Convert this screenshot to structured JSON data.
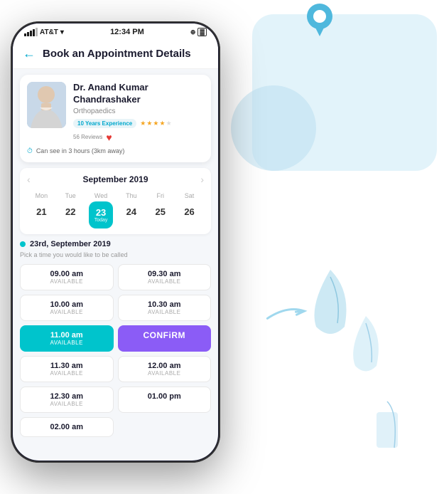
{
  "app": {
    "status_bar": {
      "carrier": "AT&T",
      "time": "12:34 PM",
      "battery": "battery"
    },
    "header": {
      "back_label": "←",
      "title": "Book an Appointment Details"
    },
    "doctor": {
      "name": "Dr. Anand Kumar Chandrashaker",
      "specialty": "Orthopaedics",
      "experience_badge": "10 Years Experience",
      "rating": 4,
      "reviews": "56 Reviews",
      "availability": "Can see in 3 hours (3km away)"
    },
    "calendar": {
      "month": "September 2019",
      "days": [
        {
          "name": "Mon",
          "num": "21",
          "active": false
        },
        {
          "name": "Tue",
          "num": "22",
          "active": false
        },
        {
          "name": "Wed",
          "num": "23",
          "active": true,
          "today": "Today"
        },
        {
          "name": "Thu",
          "num": "24",
          "active": false
        },
        {
          "name": "Fri",
          "num": "25",
          "active": false
        },
        {
          "name": "Sat",
          "num": "26",
          "active": false
        }
      ]
    },
    "date_label": "23rd, September 2019",
    "pick_prompt": "Pick a time you would like to be called",
    "slots": [
      {
        "time": "09.00 am",
        "status": "AVAILABLE",
        "selected": false,
        "confirm": false
      },
      {
        "time": "09.30 am",
        "status": "AVAILABLE",
        "selected": false,
        "confirm": false
      },
      {
        "time": "10.00 am",
        "status": "AVAILABLE",
        "selected": false,
        "confirm": false
      },
      {
        "time": "10.30 am",
        "status": "AVAILABLE",
        "selected": false,
        "confirm": false
      },
      {
        "time": "11.00 am",
        "status": "AVAILABLE",
        "selected": true,
        "confirm": false
      },
      {
        "time": "CONFiRM",
        "status": "",
        "selected": false,
        "confirm": true
      },
      {
        "time": "11.30 am",
        "status": "AVAILABLE",
        "selected": false,
        "confirm": false
      },
      {
        "time": "",
        "status": "",
        "selected": false,
        "confirm": false
      },
      {
        "time": "12.00 am",
        "status": "AVAILABLE",
        "selected": false,
        "confirm": false
      },
      {
        "time": "12.30 am",
        "status": "AVAILABLE",
        "selected": false,
        "confirm": false
      },
      {
        "time": "01.00 pm",
        "status": "",
        "selected": false,
        "confirm": false
      },
      {
        "time": "02.00 am",
        "status": "",
        "selected": false,
        "confirm": false
      }
    ]
  }
}
